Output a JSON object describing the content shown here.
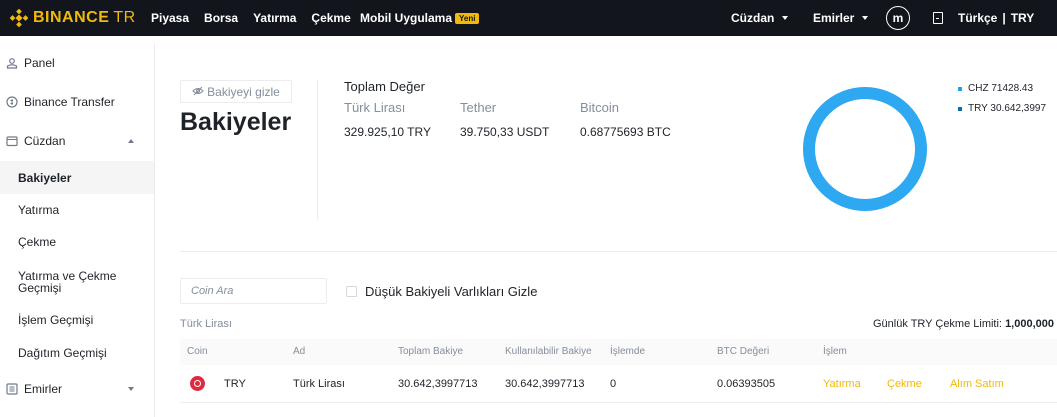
{
  "brand": {
    "name": "BINANCE",
    "suffix": "TR",
    "accent": "#f0b90b"
  },
  "topnav": {
    "items": [
      {
        "label": "Piyasa"
      },
      {
        "label": "Borsa"
      },
      {
        "label": "Yatırma"
      },
      {
        "label": "Çekme"
      }
    ],
    "mobile_app": "Mobil Uygulama",
    "mobile_badge": "Yeni"
  },
  "topright": {
    "wallet": "Cüzdan",
    "orders": "Emirler",
    "avatar_letter": "m",
    "lang": "Türkçe",
    "currency": "TRY"
  },
  "sidebar": {
    "items": [
      {
        "label": "Panel",
        "icon": "user-icon"
      },
      {
        "label": "Binance Transfer",
        "icon": "coin-circle-icon"
      },
      {
        "label": "Cüzdan",
        "icon": "wallet-icon"
      },
      {
        "label": "Bakiyeler"
      },
      {
        "label": "Yatırma"
      },
      {
        "label": "Çekme"
      },
      {
        "label": "Yatırma ve Çekme Geçmişi"
      },
      {
        "label": "İşlem Geçmişi"
      },
      {
        "label": "Dağıtım Geçmişi"
      },
      {
        "label": "Emirler",
        "icon": "list-icon"
      }
    ]
  },
  "main": {
    "hide_balance": "Bakiyeyi gizle",
    "title": "Bakiyeler",
    "total_label": "Toplam Değer",
    "currencies": [
      {
        "label": "Türk Lirası",
        "value": "329.925,10 TRY"
      },
      {
        "label": "Tether",
        "value": "39.750,33 USDT"
      },
      {
        "label": "Bitcoin",
        "value": "0.68775693 BTC"
      }
    ],
    "legend": [
      {
        "label": "CHZ 71428.43",
        "color": "#1fa3e8"
      },
      {
        "label": "TRY 30.642,3997",
        "color": "#0b6fa8"
      }
    ],
    "donut_color": "#2ea8f0",
    "search_placeholder": "Coin Ara",
    "hide_small": "Düşük Bakiyeli Varlıkları Gizle",
    "section_label": "Türk Lirası",
    "limit_label": "Günlük TRY Çekme Limiti:",
    "limit_value": "1,000,000",
    "table": {
      "headers": {
        "coin": "Coin",
        "name": "Ad",
        "total": "Toplam Bakiye",
        "available": "Kullanılabilir Bakiye",
        "in_order": "İşlemde",
        "btc_value": "BTC Değeri",
        "action": "İşlem"
      },
      "rows": [
        {
          "coin": "TRY",
          "name": "Türk Lirası",
          "total": "30.642,3997713",
          "available": "30.642,3997713",
          "in_order": "0",
          "btc_value": "0.06393505",
          "actions": {
            "deposit": "Yatırma",
            "withdraw": "Çekme",
            "trade": "Alım Satım"
          }
        }
      ]
    }
  }
}
